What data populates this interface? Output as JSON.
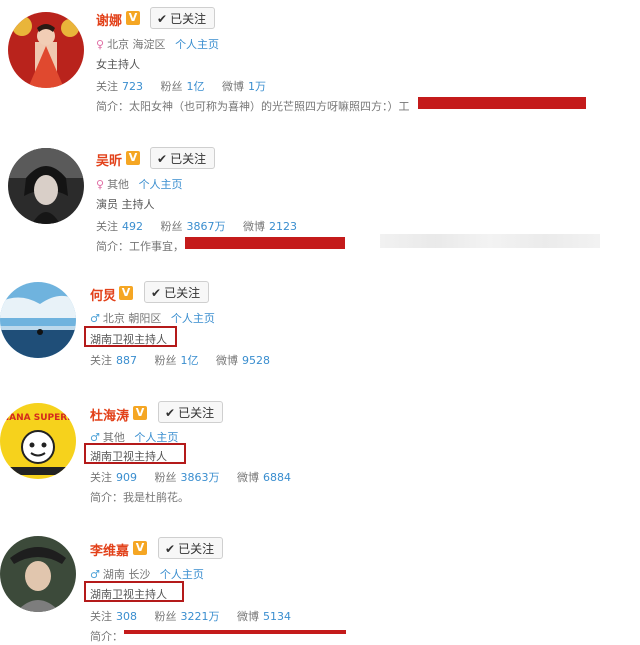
{
  "users": [
    {
      "name": "谢娜",
      "verified_badge": "V",
      "follow_label": "已关注",
      "location": "北京 海淀区",
      "homepage_link": "个人主页",
      "bio": "女主持人",
      "stats": {
        "follow_label": "关注",
        "follow_count": "723",
        "fans_label": "粉丝",
        "fans_count": "1亿",
        "weibo_label": "微博",
        "weibo_count": "1万"
      },
      "intro": "简介：太阳女神（也可称为喜神）的光芒照四方呀嘛照四方：）工"
    },
    {
      "name": "吴昕",
      "verified_badge": "V",
      "follow_label": "已关注",
      "location": "其他",
      "homepage_link": "个人主页",
      "bio": "演员 主持人",
      "stats": {
        "follow_label": "关注",
        "follow_count": "492",
        "fans_label": "粉丝",
        "fans_count": "3867万",
        "weibo_label": "微博",
        "weibo_count": "2123"
      },
      "intro": "简介：工作事宜，"
    },
    {
      "name": "何炅",
      "verified_badge": "V",
      "follow_label": "已关注",
      "location": "北京 朝阳区",
      "homepage_link": "个人主页",
      "bio": "湖南卫视主持人",
      "stats": {
        "follow_label": "关注",
        "follow_count": "887",
        "fans_label": "粉丝",
        "fans_count": "1亿",
        "weibo_label": "微博",
        "weibo_count": "9528"
      }
    },
    {
      "name": "杜海涛",
      "verified_badge": "V",
      "follow_label": "已关注",
      "location": "其他",
      "homepage_link": "个人主页",
      "bio": "湖南卫视主持人",
      "stats": {
        "follow_label": "关注",
        "follow_count": "909",
        "fans_label": "粉丝",
        "fans_count": "3863万",
        "weibo_label": "微博",
        "weibo_count": "6884"
      },
      "intro": "简介：我是杜鹃花。",
      "avatar_text": "BANANA SUPERFUN"
    },
    {
      "name": "李维嘉",
      "verified_badge": "V",
      "follow_label": "已关注",
      "location": "湖南 长沙",
      "homepage_link": "个人主页",
      "bio": "湖南卫视主持人",
      "stats": {
        "follow_label": "关注",
        "follow_count": "308",
        "fans_label": "粉丝",
        "fans_count": "3221万",
        "weibo_label": "微博",
        "weibo_count": "5134"
      },
      "intro": "简介："
    }
  ],
  "colors": {
    "name": "#e2411a",
    "link": "#3a8ecf",
    "verified": "#f5a623",
    "redaction": "#c41b1b"
  }
}
